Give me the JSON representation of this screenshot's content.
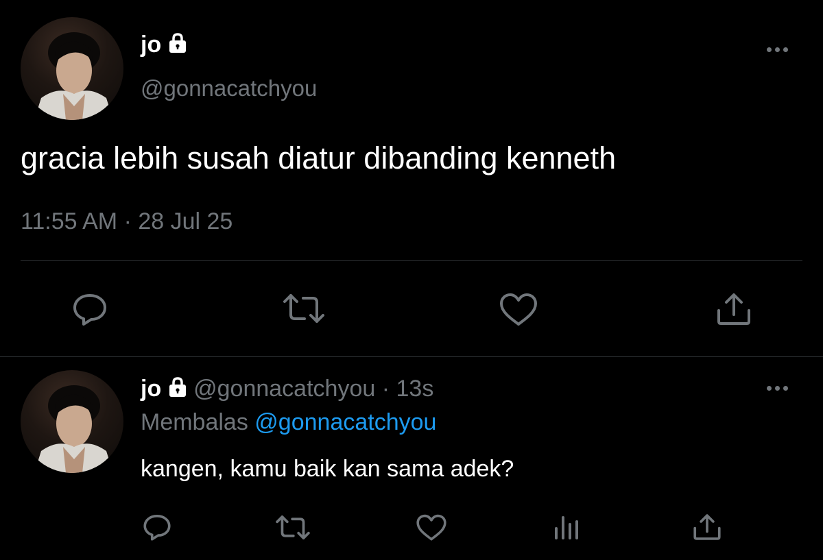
{
  "main_tweet": {
    "display_name": "jo",
    "handle": "@gonnacatchyou",
    "text": "gracia lebih susah diatur dibanding kenneth",
    "timestamp": "11:55 AM · 28 Jul 25",
    "actions": [
      "reply-icon",
      "retweet-icon",
      "like-icon",
      "share-icon"
    ]
  },
  "reply_tweet": {
    "display_name": "jo",
    "handle": "@gonnacatchyou",
    "time_ago": "· 13s",
    "replying_prefix": "Membalas",
    "replying_to": "@gonnacatchyou",
    "text": "kangen, kamu baik kan sama adek?",
    "actions": [
      "reply-icon",
      "retweet-icon",
      "like-icon",
      "views-icon",
      "share-icon"
    ]
  },
  "colors": {
    "background": "#000000",
    "text": "#e7e9ea",
    "muted": "#71767b",
    "link": "#1d9bf0",
    "divider": "#2f3336"
  }
}
